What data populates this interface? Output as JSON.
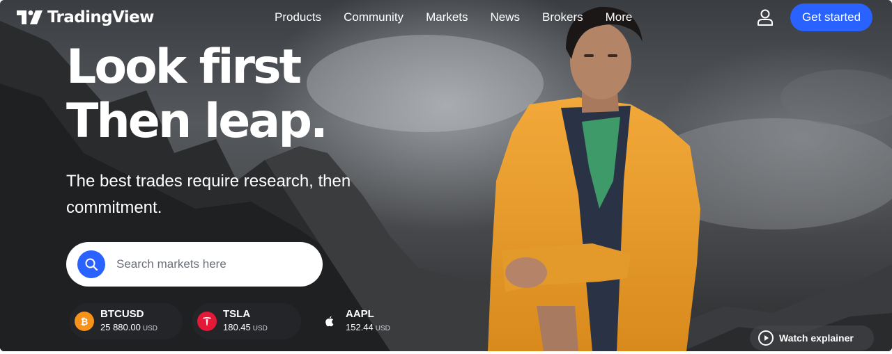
{
  "brand": {
    "name": "TradingView"
  },
  "nav": {
    "items": [
      "Products",
      "Community",
      "Markets",
      "News",
      "Brokers",
      "More"
    ],
    "cta_label": "Get started"
  },
  "hero": {
    "headline_line1": "Look first",
    "headline_line2": "Then leap.",
    "subheadline": "The best trades require research, then commitment."
  },
  "search": {
    "placeholder": "Search markets here"
  },
  "tickers": [
    {
      "symbol": "BTCUSD",
      "price": "25 880.00",
      "currency": "USD",
      "icon": "bitcoin-icon",
      "icon_color": "#f7931a"
    },
    {
      "symbol": "TSLA",
      "price": "180.45",
      "currency": "USD",
      "icon": "tesla-icon",
      "icon_color": "#e31937"
    },
    {
      "symbol": "AAPL",
      "price": "152.44",
      "currency": "USD",
      "icon": "apple-icon",
      "icon_color": "#000000"
    }
  ],
  "watch_explainer": {
    "label": "Watch explainer",
    "icon": "play-circle-icon"
  },
  "colors": {
    "accent": "#2962ff",
    "search_bg": "#ffffff",
    "text": "#ffffff"
  }
}
